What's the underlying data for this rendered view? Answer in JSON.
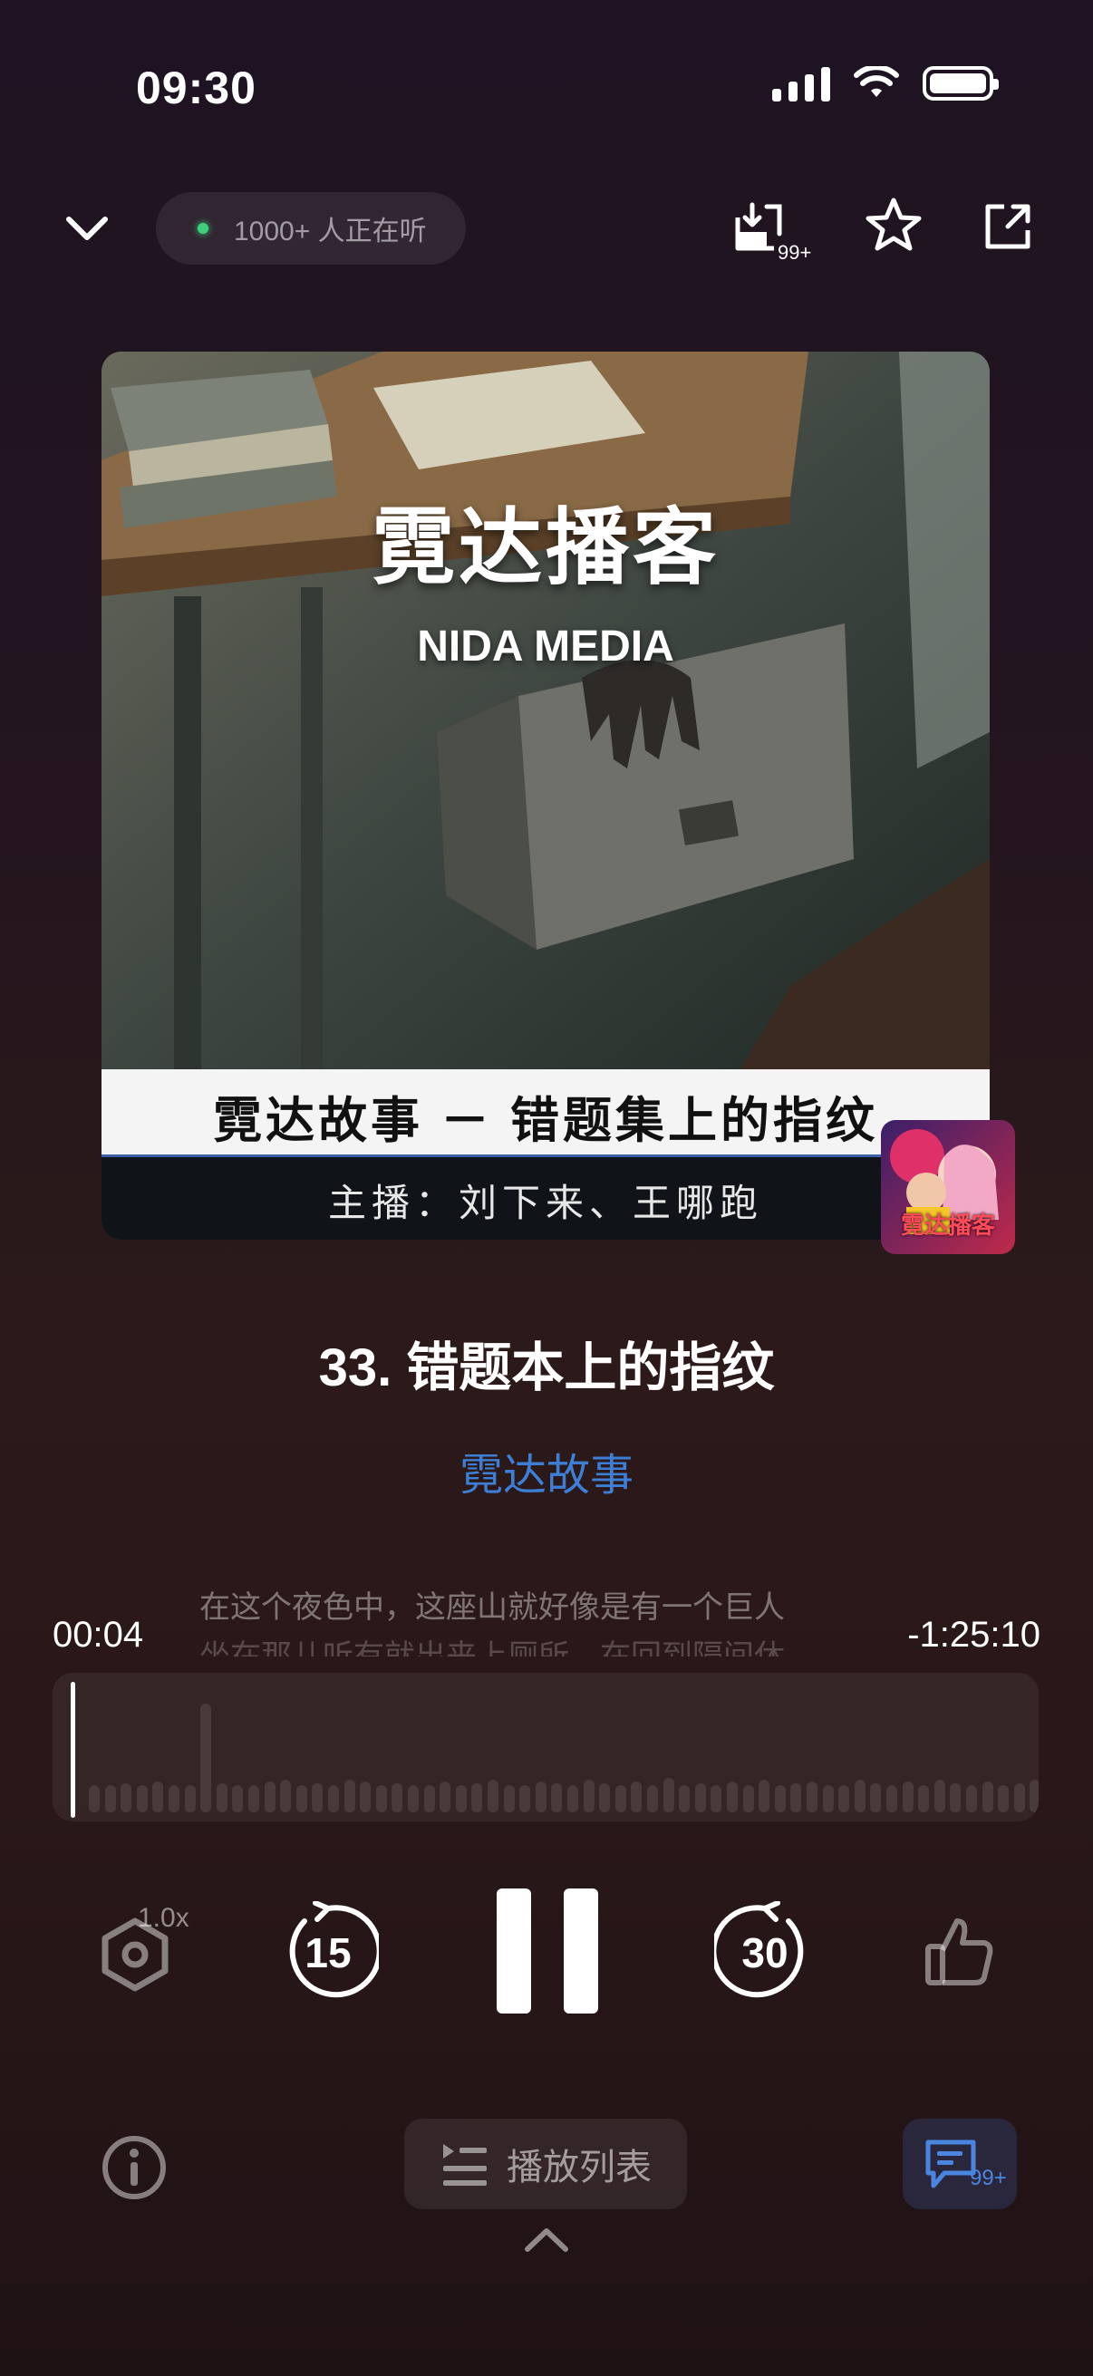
{
  "status_bar": {
    "time": "09:30"
  },
  "header": {
    "listeners": "1000+ 人正在听",
    "download_badge": "99+"
  },
  "cover": {
    "brand_cn": "霓达播客",
    "brand_en": "NIDA MEDIA",
    "banner": "霓达故事 － 错题集上的指纹",
    "hosts": "主播：刘下来、王哪跑",
    "logo_text": "霓达播客"
  },
  "episode": {
    "title": "33. 错题本上的指纹",
    "show": "霓达故事"
  },
  "subtitles": {
    "line1": "在这个夜色中，这座山就好像是有一个巨人",
    "line2": "坐在那儿听有就出来上厕所，在回到隔间休"
  },
  "progress": {
    "elapsed": "00:04",
    "remaining": "-1:25:10",
    "fraction": 0.001
  },
  "controls": {
    "speed": "1.0x",
    "rewind": "15",
    "forward": "30"
  },
  "bottom": {
    "playlist_label": "播放列表",
    "comments_badge": "99+"
  }
}
